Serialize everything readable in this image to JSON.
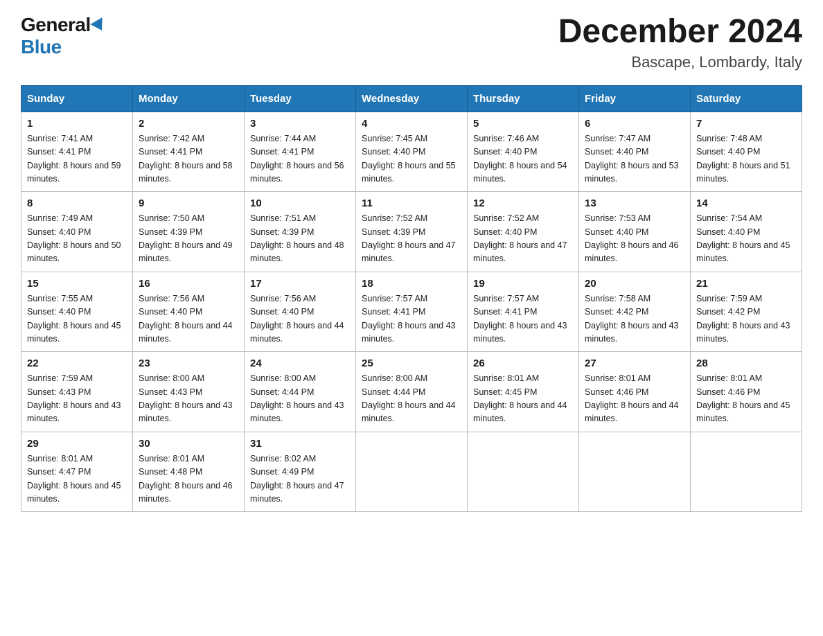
{
  "header": {
    "logo_general": "General",
    "logo_blue": "Blue",
    "month_title": "December 2024",
    "location": "Bascape, Lombardy, Italy"
  },
  "days_of_week": [
    "Sunday",
    "Monday",
    "Tuesday",
    "Wednesday",
    "Thursday",
    "Friday",
    "Saturday"
  ],
  "weeks": [
    [
      {
        "num": "1",
        "sunrise": "7:41 AM",
        "sunset": "4:41 PM",
        "daylight": "8 hours and 59 minutes."
      },
      {
        "num": "2",
        "sunrise": "7:42 AM",
        "sunset": "4:41 PM",
        "daylight": "8 hours and 58 minutes."
      },
      {
        "num": "3",
        "sunrise": "7:44 AM",
        "sunset": "4:41 PM",
        "daylight": "8 hours and 56 minutes."
      },
      {
        "num": "4",
        "sunrise": "7:45 AM",
        "sunset": "4:40 PM",
        "daylight": "8 hours and 55 minutes."
      },
      {
        "num": "5",
        "sunrise": "7:46 AM",
        "sunset": "4:40 PM",
        "daylight": "8 hours and 54 minutes."
      },
      {
        "num": "6",
        "sunrise": "7:47 AM",
        "sunset": "4:40 PM",
        "daylight": "8 hours and 53 minutes."
      },
      {
        "num": "7",
        "sunrise": "7:48 AM",
        "sunset": "4:40 PM",
        "daylight": "8 hours and 51 minutes."
      }
    ],
    [
      {
        "num": "8",
        "sunrise": "7:49 AM",
        "sunset": "4:40 PM",
        "daylight": "8 hours and 50 minutes."
      },
      {
        "num": "9",
        "sunrise": "7:50 AM",
        "sunset": "4:39 PM",
        "daylight": "8 hours and 49 minutes."
      },
      {
        "num": "10",
        "sunrise": "7:51 AM",
        "sunset": "4:39 PM",
        "daylight": "8 hours and 48 minutes."
      },
      {
        "num": "11",
        "sunrise": "7:52 AM",
        "sunset": "4:39 PM",
        "daylight": "8 hours and 47 minutes."
      },
      {
        "num": "12",
        "sunrise": "7:52 AM",
        "sunset": "4:40 PM",
        "daylight": "8 hours and 47 minutes."
      },
      {
        "num": "13",
        "sunrise": "7:53 AM",
        "sunset": "4:40 PM",
        "daylight": "8 hours and 46 minutes."
      },
      {
        "num": "14",
        "sunrise": "7:54 AM",
        "sunset": "4:40 PM",
        "daylight": "8 hours and 45 minutes."
      }
    ],
    [
      {
        "num": "15",
        "sunrise": "7:55 AM",
        "sunset": "4:40 PM",
        "daylight": "8 hours and 45 minutes."
      },
      {
        "num": "16",
        "sunrise": "7:56 AM",
        "sunset": "4:40 PM",
        "daylight": "8 hours and 44 minutes."
      },
      {
        "num": "17",
        "sunrise": "7:56 AM",
        "sunset": "4:40 PM",
        "daylight": "8 hours and 44 minutes."
      },
      {
        "num": "18",
        "sunrise": "7:57 AM",
        "sunset": "4:41 PM",
        "daylight": "8 hours and 43 minutes."
      },
      {
        "num": "19",
        "sunrise": "7:57 AM",
        "sunset": "4:41 PM",
        "daylight": "8 hours and 43 minutes."
      },
      {
        "num": "20",
        "sunrise": "7:58 AM",
        "sunset": "4:42 PM",
        "daylight": "8 hours and 43 minutes."
      },
      {
        "num": "21",
        "sunrise": "7:59 AM",
        "sunset": "4:42 PM",
        "daylight": "8 hours and 43 minutes."
      }
    ],
    [
      {
        "num": "22",
        "sunrise": "7:59 AM",
        "sunset": "4:43 PM",
        "daylight": "8 hours and 43 minutes."
      },
      {
        "num": "23",
        "sunrise": "8:00 AM",
        "sunset": "4:43 PM",
        "daylight": "8 hours and 43 minutes."
      },
      {
        "num": "24",
        "sunrise": "8:00 AM",
        "sunset": "4:44 PM",
        "daylight": "8 hours and 43 minutes."
      },
      {
        "num": "25",
        "sunrise": "8:00 AM",
        "sunset": "4:44 PM",
        "daylight": "8 hours and 44 minutes."
      },
      {
        "num": "26",
        "sunrise": "8:01 AM",
        "sunset": "4:45 PM",
        "daylight": "8 hours and 44 minutes."
      },
      {
        "num": "27",
        "sunrise": "8:01 AM",
        "sunset": "4:46 PM",
        "daylight": "8 hours and 44 minutes."
      },
      {
        "num": "28",
        "sunrise": "8:01 AM",
        "sunset": "4:46 PM",
        "daylight": "8 hours and 45 minutes."
      }
    ],
    [
      {
        "num": "29",
        "sunrise": "8:01 AM",
        "sunset": "4:47 PM",
        "daylight": "8 hours and 45 minutes."
      },
      {
        "num": "30",
        "sunrise": "8:01 AM",
        "sunset": "4:48 PM",
        "daylight": "8 hours and 46 minutes."
      },
      {
        "num": "31",
        "sunrise": "8:02 AM",
        "sunset": "4:49 PM",
        "daylight": "8 hours and 47 minutes."
      },
      null,
      null,
      null,
      null
    ]
  ]
}
